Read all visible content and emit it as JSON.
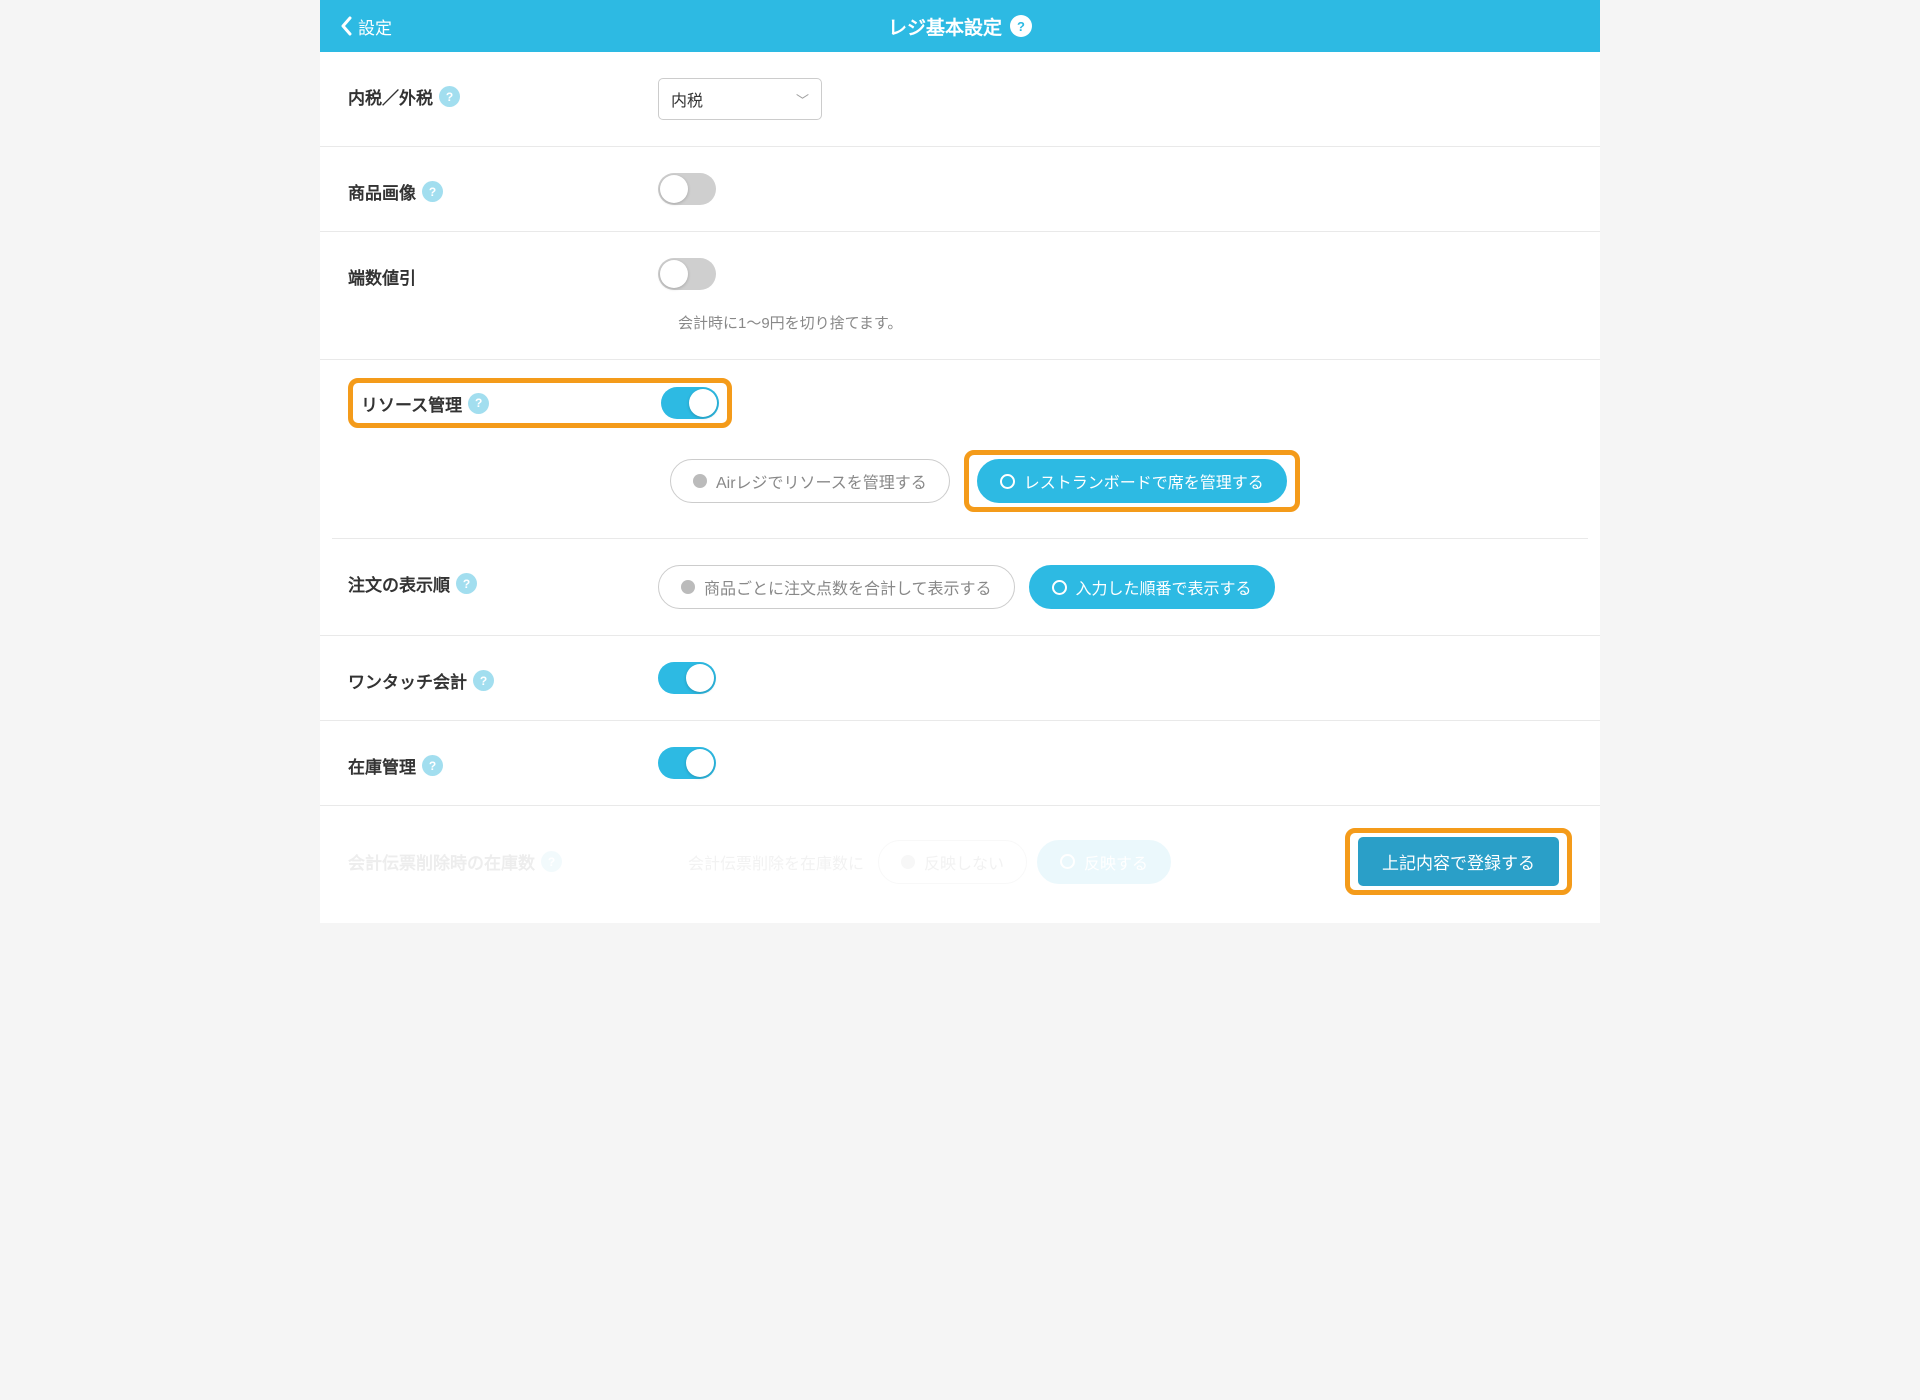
{
  "header": {
    "back_label": "設定",
    "title": "レジ基本設定"
  },
  "tax": {
    "label": "内税／外税",
    "value": "内税"
  },
  "product_image": {
    "label": "商品画像",
    "on": false
  },
  "rounding": {
    "label": "端数値引",
    "on": false,
    "hint": "会計時に1〜9円を切り捨てます。"
  },
  "resource": {
    "label": "リソース管理",
    "on": true,
    "options": {
      "airregi": "Airレジでリソースを管理する",
      "restaurant": "レストランボードで席を管理する",
      "selected": "restaurant"
    }
  },
  "order_display": {
    "label": "注文の表示順",
    "options": {
      "aggregate": "商品ごとに注文点数を合計して表示する",
      "sequential": "入力した順番で表示する",
      "selected": "sequential"
    }
  },
  "onetouch": {
    "label": "ワンタッチ会計",
    "on": true
  },
  "inventory": {
    "label": "在庫管理",
    "on": true
  },
  "footer": {
    "label": "会計伝票削除時の在庫数",
    "sublabel": "会計伝票削除を在庫数に",
    "noreflect": "反映しない",
    "reflect": "反映する",
    "submit": "上記内容で登録する"
  }
}
